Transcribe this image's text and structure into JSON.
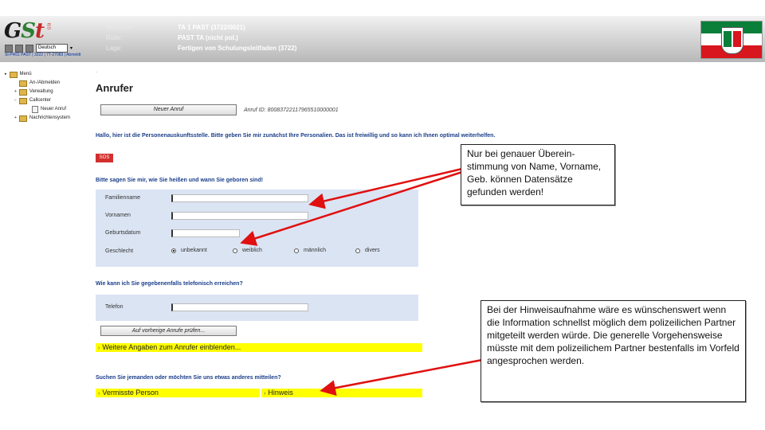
{
  "header": {
    "logo": {
      "g": "G",
      "s": "S",
      "t": "t",
      "mini": "GSt"
    },
    "language": "Deutsch",
    "link": "St-PR01 PAST | 3222 | 7T-27083 | Abmeldt",
    "user_label": "Benutzer:",
    "user_value": "TA 1 PAST (3722/0021)",
    "role_label": "Rolle:",
    "role_value": "PAST TA (nicht pol.)",
    "location_label": "Lage:",
    "location_value": "Fertigen von Schulungsleitfaden (3722)"
  },
  "sidebar": {
    "items": [
      "Menü",
      "An-/Abmelden",
      "Verwaltung",
      "Callcenter",
      "Neuer Anruf",
      "Nachrichtensystem"
    ]
  },
  "main": {
    "dot": "·",
    "title": "Anrufer",
    "new_call_button": "Neuer Anruf",
    "call_id": "Anruf ID: 80083722117965510000001",
    "intro": "Hallo, hier ist die Personenauskunftsstelle. Bitte geben Sie mir zunächst Ihre Personalien. Das ist freiwillig und so kann ich Ihnen optimal weiterhelfen.",
    "sos": "SOS",
    "personal_heading": "Bitte sagen Sie mir, wie Sie heißen und wann Sie geboren sind!",
    "labels": {
      "lastname": "Familienname",
      "firstname": "Vornamen",
      "birthdate": "Geburtsdatum",
      "gender": "Geschlecht"
    },
    "gender_options": [
      "unbekannt",
      "weiblich",
      "männlich",
      "divers"
    ],
    "phone_heading": "Wie kann ich Sie gegebenenfalls telefonisch erreichen?",
    "phone_label": "Telefon",
    "check_button": "Auf vorherige Anrufe prüfen...",
    "more_info": "Weitere Angaben zum Anrufer einblenden...",
    "search_heading": "Suchen Sie jemanden oder möchten Sie uns etwas anderes mitteilen?",
    "missing_person": "Vermisste Person",
    "hint": "Hinweis"
  },
  "callouts": {
    "top": "Nur bei genauer Überein-stimmung von Name, Vorname, Geb. können Datensätze gefunden werden!",
    "bottom": "Bei der Hinweisaufnahme wäre es wünschenswert wenn die Information schnellst möglich dem polizeilichen Partner mitgeteilt werden würde. Die generelle Vorgehensweise müsste mit dem polizeilichem Partner bestenfalls im Vorfeld angesprochen werden."
  },
  "colors": {
    "annotation_arrow": "#e01010",
    "highlight_bar": "#ffff00",
    "form_background": "#dbe4f3",
    "heading_text": "#1b3e8a"
  }
}
